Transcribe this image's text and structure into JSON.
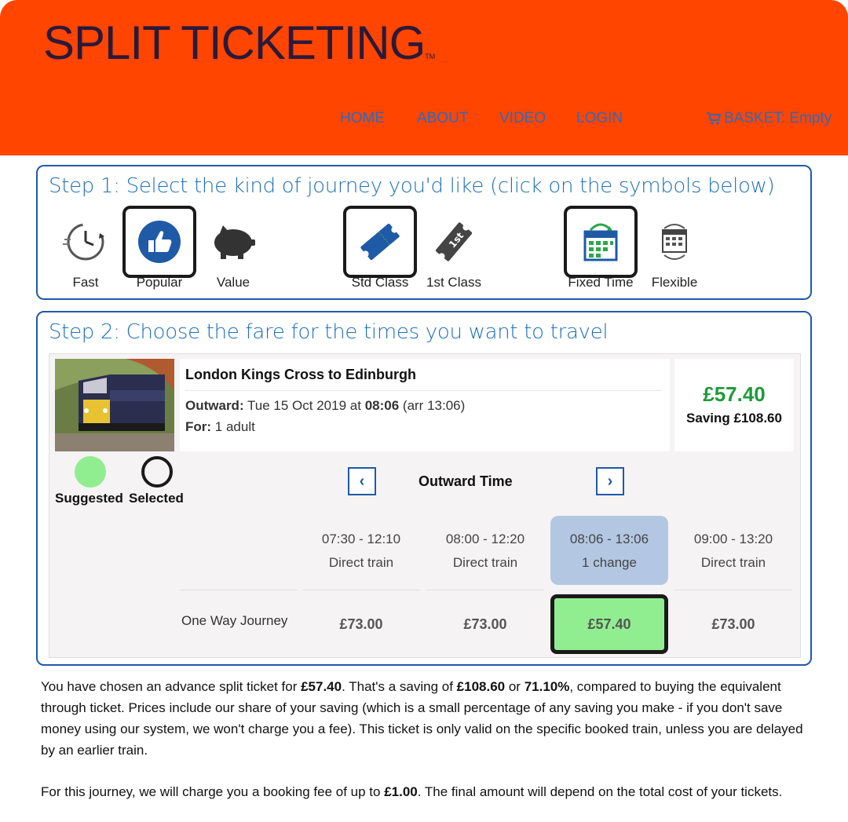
{
  "header": {
    "logo_text": "SPLIT TICKETING",
    "logo_tm": "TM",
    "nav": [
      "HOME",
      "ABOUT",
      "VIDEO",
      "LOGIN"
    ],
    "basket": "BASKET: Empty",
    "brand_color": "#ff4500",
    "link_color": "#2b6bbd"
  },
  "step1": {
    "title": "Step 1: Select the kind of journey you'd like (click on the symbols below)",
    "options": [
      {
        "label": "Fast",
        "icon": "clock-icon",
        "selected": false
      },
      {
        "label": "Popular",
        "icon": "thumbs-up-icon",
        "selected": true
      },
      {
        "label": "Value",
        "icon": "piggy-bank-icon",
        "selected": false
      },
      {
        "label": "Std Class",
        "icon": "ticket-icon",
        "selected": true
      },
      {
        "label": "1st Class",
        "icon": "first-class-ticket-icon",
        "selected": false
      },
      {
        "label": "Fixed Time",
        "icon": "calendar-icon",
        "selected": true
      },
      {
        "label": "Flexible",
        "icon": "flexible-calendar-icon",
        "selected": false
      }
    ]
  },
  "step2": {
    "title": "Step 2: Choose the fare for the times you want to travel",
    "journey": {
      "title": "London Kings Cross to Edinburgh",
      "outward_label": "Outward:",
      "outward_date": "Tue 15 Oct 2019 at",
      "outward_time": "08:06",
      "outward_arr": "(arr 13:06)",
      "for_label": "For:",
      "for_value": "1 adult"
    },
    "price": "£57.40",
    "saving": "Saving £108.60",
    "legend": {
      "suggested": "Suggested",
      "selected": "Selected"
    },
    "outward_time_label": "Outward Time",
    "prev_arrow": "‹",
    "next_arrow": "›",
    "times": [
      {
        "range": "07:30 - 12:10",
        "type": "Direct train",
        "selected": false
      },
      {
        "range": "08:00 - 12:20",
        "type": "Direct train",
        "selected": false
      },
      {
        "range": "08:06 - 13:06",
        "type": "1 change",
        "selected": true
      },
      {
        "range": "09:00 - 13:20",
        "type": "Direct train",
        "selected": false
      }
    ],
    "row_label": "One Way Journey",
    "fares": [
      "£73.00",
      "£73.00",
      "£57.40",
      "£73.00"
    ],
    "selected_fare_index": 2
  },
  "info": {
    "p1": [
      "You have chosen an advance split ticket for ",
      "£57.40",
      ". That's a saving of ",
      "£108.60",
      " or ",
      "71.10%",
      ", compared to buying the equivalent through ticket. Prices include our share of your saving (which is a small percentage of any saving you make - if you don't save money using our system, we won't charge you a fee). This ticket is only valid on the specific booked train, unless you are delayed by an earlier train."
    ],
    "p2": [
      "For this journey, we will charge you a booking fee of up to ",
      "£1.00",
      ". The final amount will depend on the total cost of your tickets."
    ]
  }
}
